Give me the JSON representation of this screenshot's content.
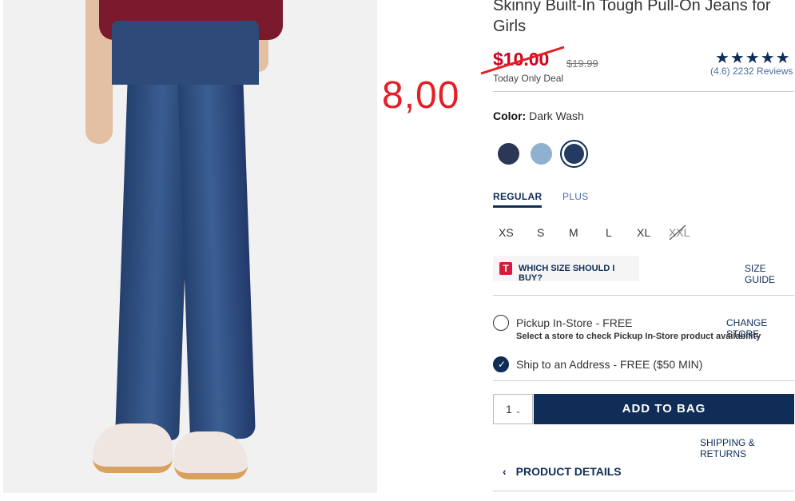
{
  "product": {
    "title": "Skinny Built-In Tough Pull-On Jeans for Girls",
    "sale_price": "$10.00",
    "original_price": "$19.99",
    "deal_label": "Today Only Deal",
    "rating_stars": "★★★★★",
    "reviews": "(4.6) 2232 Reviews"
  },
  "annotation": {
    "handwritten_price": "8,00",
    "color": "#e61f26"
  },
  "color": {
    "label": "Color:",
    "value": "Dark Wash",
    "swatch_colors": [
      "#2b3754",
      "#8fb0cf",
      "#233a62"
    ]
  },
  "size_tabs": [
    "REGULAR",
    "PLUS"
  ],
  "sizes": [
    "XS",
    "S",
    "M",
    "L",
    "XL",
    "XXL"
  ],
  "fit": {
    "badge": "T",
    "label": "WHICH SIZE SHOULD I BUY?",
    "guide": "SIZE GUIDE"
  },
  "delivery": {
    "pickup": "Pickup In-Store - FREE",
    "pickup_sub": "Select a store to check Pickup In-Store product availability",
    "change_store": "CHANGE STORE",
    "ship": "Ship to an Address - FREE ($50 MIN)"
  },
  "cart": {
    "qty": "1",
    "add_to_bag": "ADD TO BAG",
    "shipping_returns": "SHIPPING & RETURNS"
  },
  "details": {
    "label": "PRODUCT DETAILS"
  },
  "colors": {
    "brand_navy": "#0f2d56",
    "sale_red": "#d0021b"
  }
}
